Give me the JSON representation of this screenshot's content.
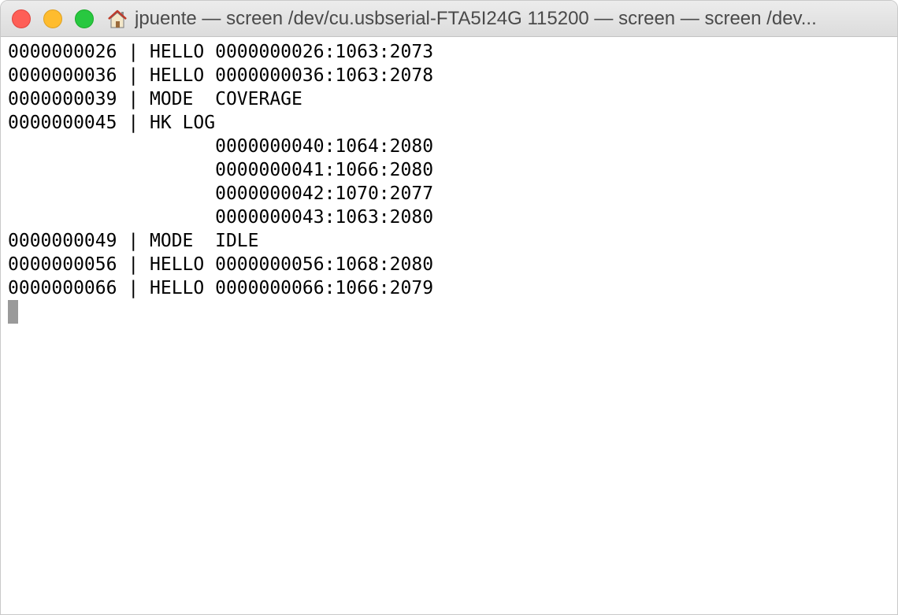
{
  "window": {
    "title": "jpuente — screen /dev/cu.usbserial-FTA5I24G 115200 — screen — screen /dev...",
    "icon": "home-icon",
    "colors": {
      "close": "#fe5f57",
      "minimize": "#febc2e",
      "zoom": "#28c840"
    }
  },
  "terminal": {
    "lines": [
      "0000000026 | HELLO 0000000026:1063:2073",
      "0000000036 | HELLO 0000000036:1063:2078",
      "0000000039 | MODE  COVERAGE",
      "0000000045 | HK LOG",
      "                   0000000040:1064:2080",
      "                   0000000041:1066:2080",
      "                   0000000042:1070:2077",
      "                   0000000043:1063:2080",
      "0000000049 | MODE  IDLE",
      "0000000056 | HELLO 0000000056:1068:2080",
      "0000000066 | HELLO 0000000066:1066:2079"
    ]
  }
}
